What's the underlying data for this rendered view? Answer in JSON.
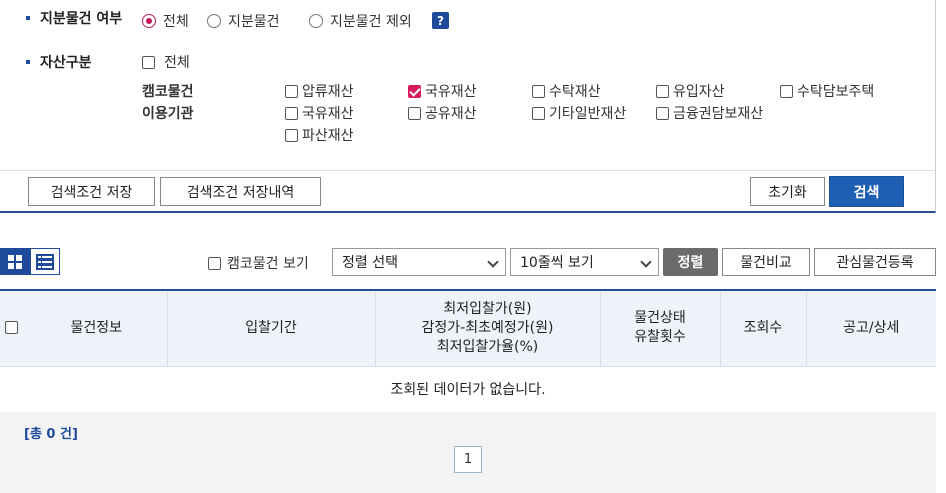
{
  "filters": {
    "share_status": {
      "label": "지분물건 여부",
      "options": [
        "전체",
        "지분물건",
        "지분물건 제외"
      ],
      "selected": "전체",
      "help": "?"
    },
    "asset_type": {
      "label": "자산구분",
      "all_label": "전체",
      "group1_label": "캠코물건",
      "group2_label": "이용기관",
      "group1_options": [
        "압류재산",
        "국유재산",
        "수탁재산",
        "유입자산",
        "수탁담보주택"
      ],
      "group1_checked": "국유재산",
      "group2_options": [
        "국유재산",
        "공유재산",
        "기타일반재산",
        "금융권담보재산",
        "파산재산"
      ]
    }
  },
  "buttons": {
    "save_search": "검색조건 저장",
    "saved_history": "검색조건 저장내역",
    "reset": "초기화",
    "search": "검색"
  },
  "toolbar": {
    "kamco_only": "캠코물건 보기",
    "sort_select": "정렬 선택",
    "page_size": "10줄씩 보기",
    "sort_button": "정렬",
    "compare": "물건비교",
    "favorite": "관심물건등록"
  },
  "table": {
    "headers": [
      "물건정보",
      "입찰기간",
      "최저입찰가(원)\n감정가-최초예정가(원)\n최저입찰가율(%)",
      "물건상태\n유찰횟수",
      "조회수",
      "공고/상세"
    ],
    "empty_message": "조회된 데이터가 없습니다."
  },
  "footer": {
    "total": "[총 0 건]",
    "page": "1"
  },
  "colors": {
    "accent": "#1f4a9c",
    "primary_button": "#1f5fb4",
    "radio_selected": "#c2185b",
    "checkbox_checked": "#d81b60"
  }
}
